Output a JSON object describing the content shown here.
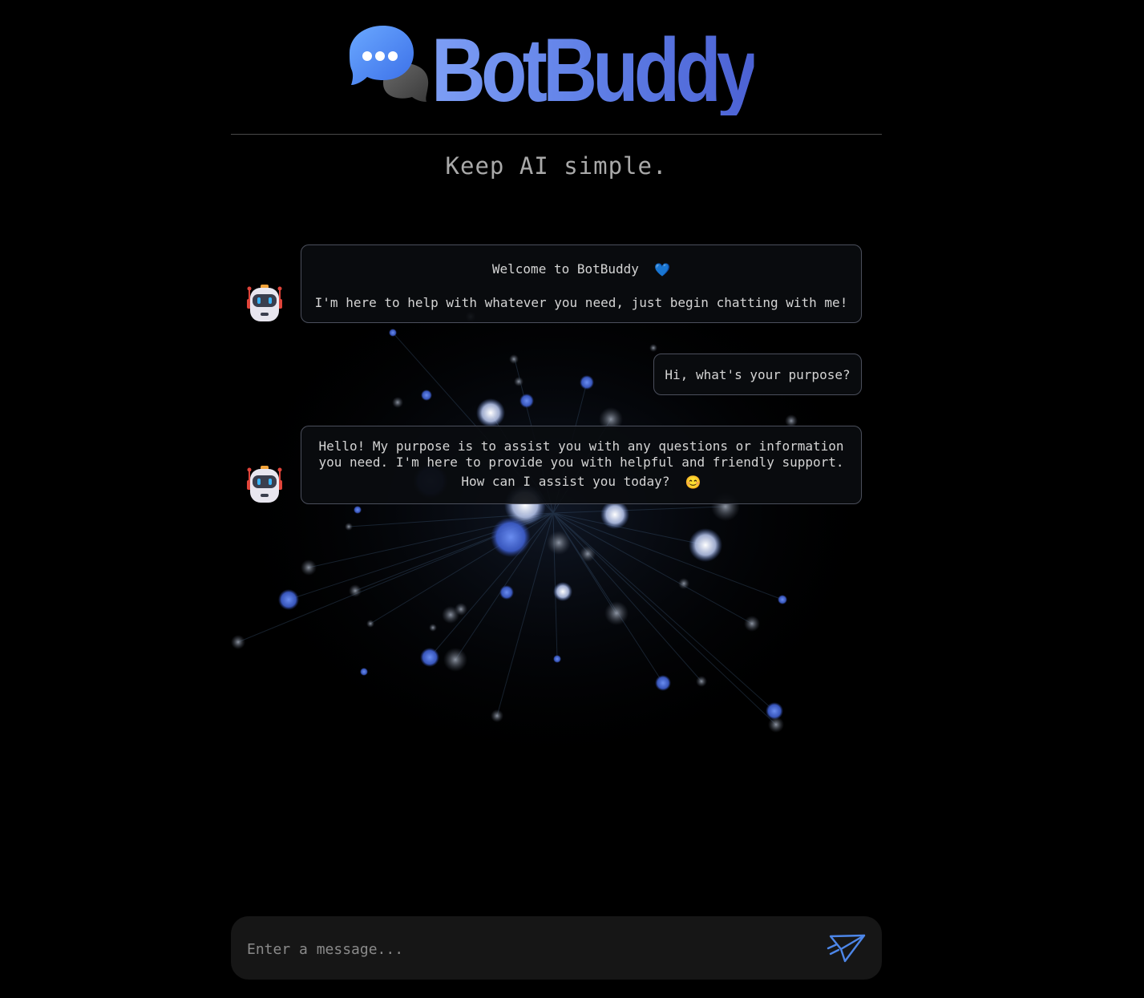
{
  "brand": {
    "name": "BotBuddy",
    "logo_icon": "chat-bubbles-icon",
    "accent_color": "#6b8cf0"
  },
  "tagline": "Keep AI simple.",
  "messages": [
    {
      "role": "bot",
      "avatar_icon": "robot-icon",
      "lines": [
        "Welcome to BotBuddy",
        "I'm here to help with whatever you need, just begin chatting with me!"
      ],
      "emoji": "💙"
    },
    {
      "role": "user",
      "text": "Hi, what's your purpose?"
    },
    {
      "role": "bot",
      "avatar_icon": "robot-icon",
      "lines": [
        "Hello! My purpose is to assist you with any questions or information",
        "you need. I'm here to provide you with helpful and friendly support.",
        "How can I assist you today?"
      ],
      "emoji": "😊"
    }
  ],
  "composer": {
    "placeholder": "Enter a message...",
    "value": "",
    "send_icon": "send-paper-plane-icon",
    "send_color": "#4d86e8"
  }
}
